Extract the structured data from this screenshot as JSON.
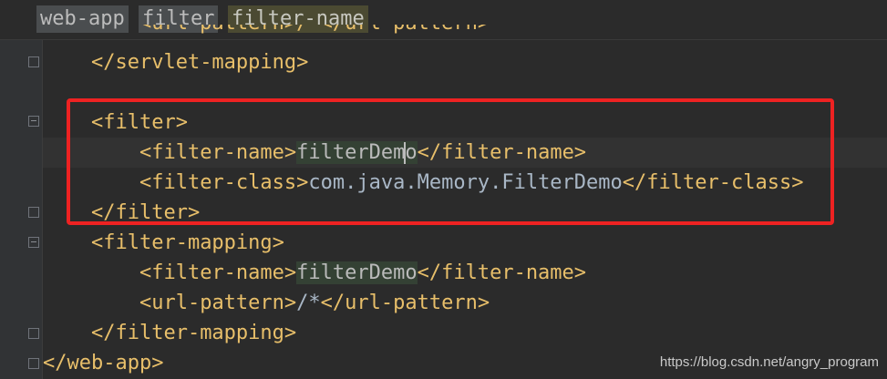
{
  "breadcrumb": {
    "items": [
      "web-app",
      "filter",
      "filter-name"
    ]
  },
  "editor": {
    "partial_line": "        <url-pattern>/*</url-pattern>",
    "lines": [
      {
        "indent": "    ",
        "parts": [
          {
            "t": "tag",
            "v": "</servlet-mapping>"
          }
        ]
      },
      {
        "indent": "",
        "parts": []
      },
      {
        "indent": "    ",
        "parts": [
          {
            "t": "tag",
            "v": "<filter>"
          }
        ]
      },
      {
        "indent": "        ",
        "parts": [
          {
            "t": "tag",
            "v": "<filter-name>"
          },
          {
            "t": "hl",
            "v": "filterDemo"
          },
          {
            "t": "tag",
            "v": "</filter-name>"
          }
        ]
      },
      {
        "indent": "        ",
        "parts": [
          {
            "t": "tag",
            "v": "<filter-class>"
          },
          {
            "t": "txt",
            "v": "com.java.Memory.FilterDemo"
          },
          {
            "t": "tag",
            "v": "</filter-class>"
          }
        ]
      },
      {
        "indent": "    ",
        "parts": [
          {
            "t": "tag",
            "v": "</filter>"
          }
        ]
      },
      {
        "indent": "    ",
        "parts": [
          {
            "t": "tag",
            "v": "<filter-mapping>"
          }
        ]
      },
      {
        "indent": "        ",
        "parts": [
          {
            "t": "tag",
            "v": "<filter-name>"
          },
          {
            "t": "hl",
            "v": "filterDemo"
          },
          {
            "t": "tag",
            "v": "</filter-name>"
          }
        ]
      },
      {
        "indent": "        ",
        "parts": [
          {
            "t": "tag",
            "v": "<url-pattern>"
          },
          {
            "t": "txt",
            "v": "/*"
          },
          {
            "t": "tag",
            "v": "</url-pattern>"
          }
        ]
      },
      {
        "indent": "    ",
        "parts": [
          {
            "t": "tag",
            "v": "</filter-mapping>"
          }
        ]
      },
      {
        "indent": "",
        "parts": [
          {
            "t": "tag",
            "v": "</web-app>"
          }
        ]
      }
    ]
  },
  "gutter": {
    "intention_icon": "lightbulb-icon"
  },
  "annotation": {
    "color": "#ee2222"
  },
  "watermark": "https://blog.csdn.net/angry_program"
}
